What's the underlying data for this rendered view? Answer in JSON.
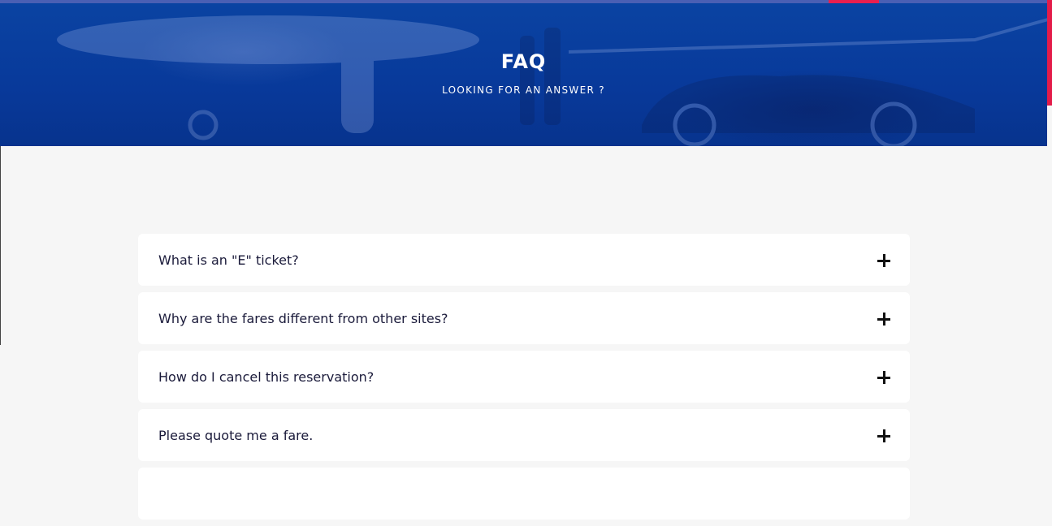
{
  "hero": {
    "title": "FAQ",
    "subtitle": "LOOKING FOR AN ANSWER ?"
  },
  "faq": {
    "items": [
      {
        "question": "What is an \"E\" ticket?",
        "icon": "plus-icon"
      },
      {
        "question": "Why are the fares different from other sites?",
        "icon": "plus-icon"
      },
      {
        "question": "How do I cancel this reservation?",
        "icon": "plus-icon"
      },
      {
        "question": "Please quote me a fare.",
        "icon": "plus-icon"
      }
    ]
  },
  "colors": {
    "hero_blue": "#0a43a2",
    "accent_red": "#ea1f4f",
    "page_background": "#f6f6f6",
    "card_background": "#ffffff",
    "question_text": "#1a1a3a"
  }
}
